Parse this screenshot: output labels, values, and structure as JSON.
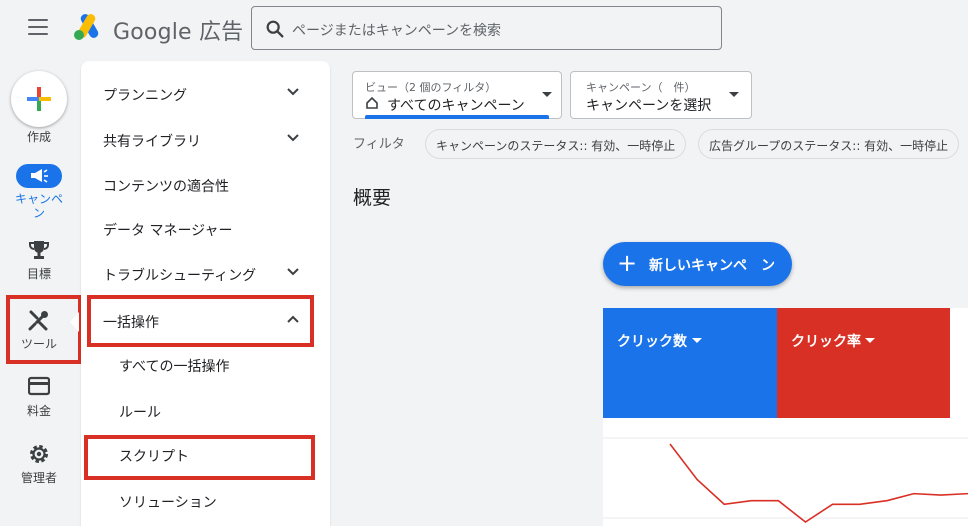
{
  "header": {
    "brand": "Google 広告",
    "search_placeholder": "ページまたはキャンペーンを検索"
  },
  "rail": {
    "create": "作成",
    "campaign_line1": "キャンペ",
    "campaign_line2": "ン",
    "goals": "目標",
    "tools": "ツール",
    "billing": "料金",
    "admin": "管理者"
  },
  "menu": {
    "planning": "プランニング",
    "shared_library": "共有ライブラリ",
    "content_suitability": "コンテンツの適合性",
    "data_manager": "データ マネージャー",
    "troubleshooting": "トラブルシューティング",
    "bulk_actions": "一括操作",
    "all_bulk_actions": "すべての一括操作",
    "rules": "ルール",
    "scripts": "スクリプト",
    "solutions": "ソリューション"
  },
  "view_dropdown": {
    "small": "ビュー（2 個のフィルタ）",
    "main": "すべてのキャンペーン"
  },
  "campaign_dropdown": {
    "small": "キャンペーン（　件）",
    "main": "キャンペーンを選択"
  },
  "filters": {
    "label": "フィルタ",
    "chip1": "キャンペーンのステータス:: 有効、一時停止",
    "chip2": "広告グループのステータス:: 有効、一時停止"
  },
  "overview": {
    "title": "概要",
    "new_campaign": "新しいキャンペ　ン"
  },
  "metrics": {
    "clicks": "クリック数",
    "ctr": "クリック率",
    "clicks_color": "#1a73e8",
    "ctr_color": "#d93025"
  },
  "chart_data": {
    "type": "line",
    "series": [
      {
        "values": [
          10,
          5,
          1.5,
          2,
          2,
          -1,
          1.5,
          1.5,
          2,
          3,
          2.8,
          3
        ]
      }
    ]
  }
}
